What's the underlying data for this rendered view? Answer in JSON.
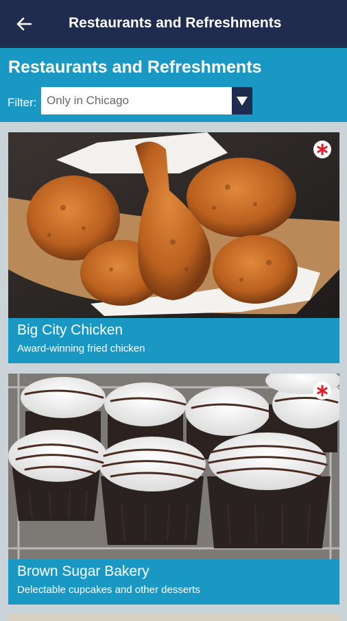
{
  "appbar": {
    "title": "Restaurants and Refreshments",
    "back_icon": "arrow-left-icon"
  },
  "header": {
    "heading": "Restaurants and Refreshments",
    "filter_label": "Filter:",
    "filter_value": "Only in Chicago"
  },
  "cards": [
    {
      "name": "Big City Chicken",
      "description": "Award-winning fried chicken",
      "badge_icon": "chicago-star-icon"
    },
    {
      "name": "Brown Sugar Bakery",
      "description": "Delectable cupcakes and other desserts",
      "badge_icon": "chicago-star-icon"
    }
  ],
  "colors": {
    "appbar": "#1f2c4e",
    "accent": "#1a98c4",
    "background": "#c9d3d8",
    "badge_star": "#e31b23"
  }
}
